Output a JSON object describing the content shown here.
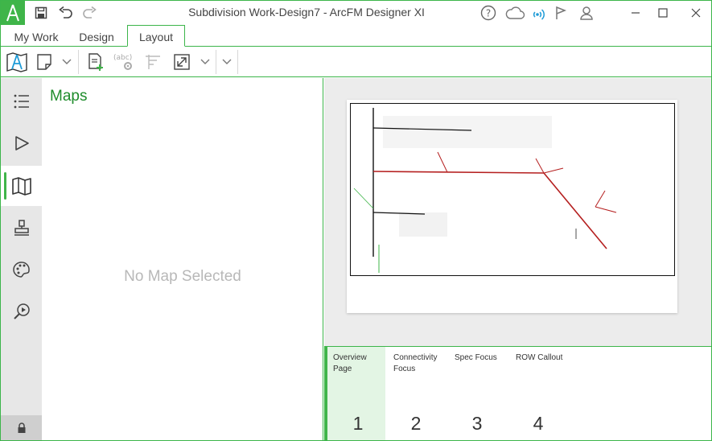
{
  "window": {
    "title": "Subdivision Work-Design7 - ArcFM Designer XI",
    "accent_color": "#3fb549"
  },
  "titlebar_icons": [
    "app-logo-icon",
    "save-icon",
    "undo-icon",
    "redo-icon",
    "help-icon",
    "cloud-icon",
    "signal-icon",
    "flag-icon",
    "user-icon"
  ],
  "tabs": [
    {
      "label": "My Work"
    },
    {
      "label": "Design"
    },
    {
      "label": "Layout"
    }
  ],
  "active_tab": "Layout",
  "rail": {
    "items": [
      "list-icon",
      "play-icon",
      "map-icon",
      "stamp-icon",
      "palette-icon",
      "search-play-icon"
    ],
    "active": "map-icon"
  },
  "maps_panel": {
    "title": "Maps",
    "empty_text": "No Map Selected"
  },
  "pages": [
    {
      "label": "Overview Page",
      "number": "1"
    },
    {
      "label": "Connectivity Focus",
      "number": "2"
    },
    {
      "label": "Spec Focus",
      "number": "3"
    },
    {
      "label": "ROW Callout",
      "number": "4"
    }
  ]
}
